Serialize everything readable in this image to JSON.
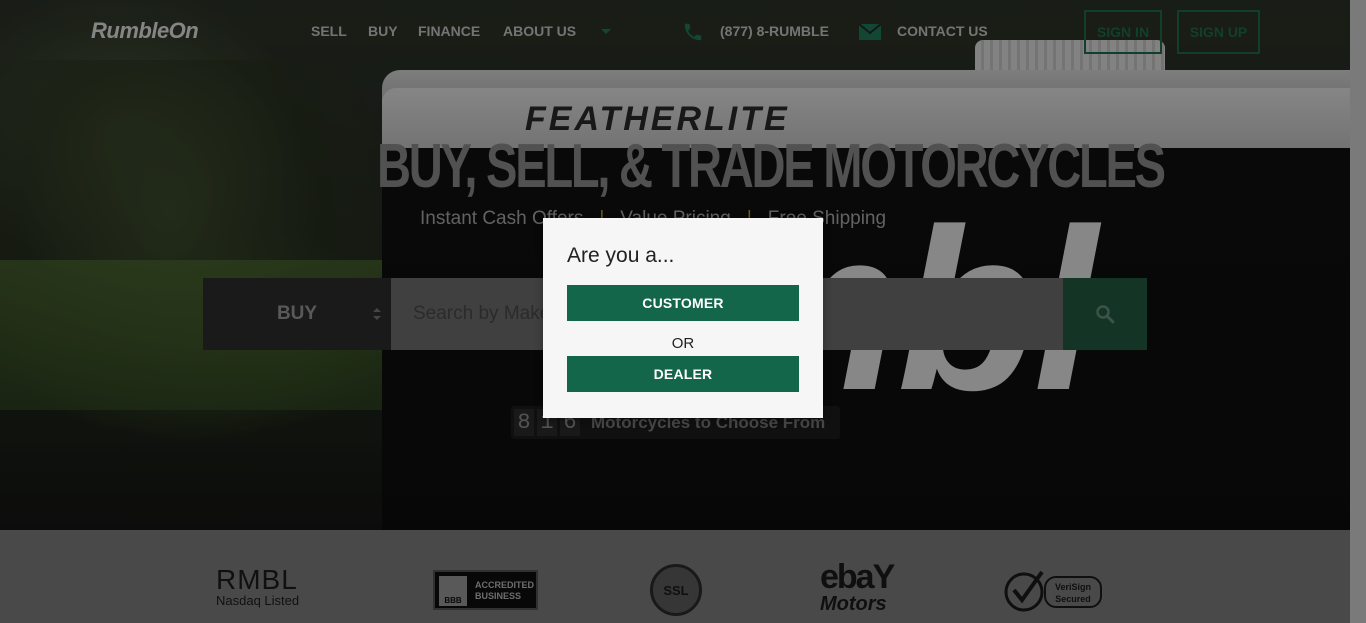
{
  "nav": {
    "logo": "RumbleOn",
    "links": [
      "SELL",
      "BUY",
      "FINANCE",
      "ABOUT US"
    ],
    "phone": "(877) 8-RUMBLE",
    "contact": "CONTACT US",
    "sign_in": "SIGN IN",
    "sign_up": "SIGN UP"
  },
  "hero": {
    "headline": "BUY, SELL, & TRADE MOTORCYCLES",
    "tagline": [
      "Instant Cash Offers",
      "Value Pricing",
      "Free Shipping"
    ],
    "separator": "|",
    "trailer_brand": "FEATHERLITE",
    "trailer_letters": "umbl"
  },
  "search": {
    "mode_selected": "BUY",
    "placeholder": "Search by Make, Model or Keyword"
  },
  "counter": {
    "digits": [
      "8",
      "1",
      "6"
    ],
    "label": "Motorcycles to Choose From"
  },
  "trust": {
    "rmbl": "RMBL",
    "rmbl_sub": "Nasdaq Listed",
    "bbb_line1": "ACCREDITED",
    "bbb_line2": "BUSINESS",
    "bbb": "BBB",
    "ssl": "SSL",
    "ebay": "ebaY",
    "ebay_motors": "Motors",
    "verisign_1": "VeriSign",
    "verisign_2": "Secured"
  },
  "modal": {
    "title": "Are you a...",
    "customer": "CUSTOMER",
    "or": "OR",
    "dealer": "DEALER"
  },
  "colors": {
    "brand_green": "#136649",
    "accent_gold": "#b79d2a"
  }
}
